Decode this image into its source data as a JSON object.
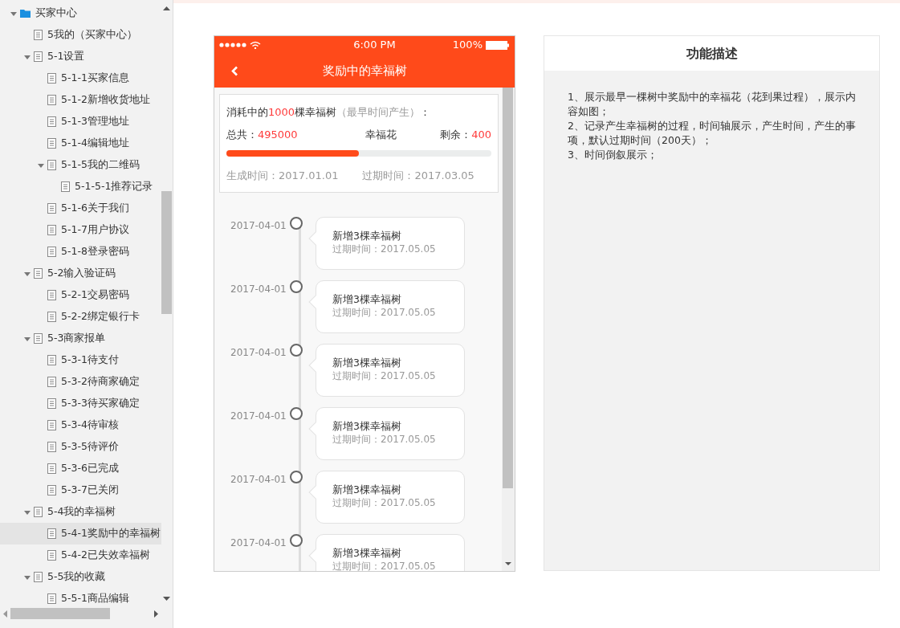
{
  "sidebar": {
    "tree": [
      {
        "label": "买家中心",
        "kind": "folder",
        "expanded": true,
        "selected": false,
        "children": [
          {
            "label": "5我的（买家中心）",
            "kind": "page",
            "selected": false
          },
          {
            "label": "5-1设置",
            "kind": "page",
            "expanded": true,
            "selected": false,
            "children": [
              {
                "label": "5-1-1买家信息",
                "kind": "page",
                "selected": false
              },
              {
                "label": "5-1-2新增收货地址",
                "kind": "page",
                "selected": false
              },
              {
                "label": "5-1-3管理地址",
                "kind": "page",
                "selected": false
              },
              {
                "label": "5-1-4编辑地址",
                "kind": "page",
                "selected": false
              },
              {
                "label": "5-1-5我的二维码",
                "kind": "page",
                "expanded": true,
                "selected": false,
                "children": [
                  {
                    "label": "5-1-5-1推荐记录",
                    "kind": "page",
                    "selected": false
                  }
                ]
              },
              {
                "label": "5-1-6关于我们",
                "kind": "page",
                "selected": false
              },
              {
                "label": "5-1-7用户协议",
                "kind": "page",
                "selected": false
              },
              {
                "label": "5-1-8登录密码",
                "kind": "page",
                "selected": false
              }
            ]
          },
          {
            "label": "5-2输入验证码",
            "kind": "page",
            "expanded": true,
            "selected": false,
            "children": [
              {
                "label": "5-2-1交易密码",
                "kind": "page",
                "selected": false
              },
              {
                "label": "5-2-2绑定银行卡",
                "kind": "page",
                "selected": false
              }
            ]
          },
          {
            "label": "5-3商家报单",
            "kind": "page",
            "expanded": true,
            "selected": false,
            "children": [
              {
                "label": "5-3-1待支付",
                "kind": "page",
                "selected": false
              },
              {
                "label": "5-3-2待商家确定",
                "kind": "page",
                "selected": false
              },
              {
                "label": "5-3-3待买家确定",
                "kind": "page",
                "selected": false
              },
              {
                "label": "5-3-4待审核",
                "kind": "page",
                "selected": false
              },
              {
                "label": "5-3-5待评价",
                "kind": "page",
                "selected": false
              },
              {
                "label": "5-3-6已完成",
                "kind": "page",
                "selected": false
              },
              {
                "label": "5-3-7已关闭",
                "kind": "page",
                "selected": false
              }
            ]
          },
          {
            "label": "5-4我的幸福树",
            "kind": "page",
            "expanded": true,
            "selected": false,
            "children": [
              {
                "label": "5-4-1奖励中的幸福树",
                "kind": "page",
                "selected": true
              },
              {
                "label": "5-4-2已失效幸福树",
                "kind": "page",
                "selected": false
              }
            ]
          },
          {
            "label": "5-5我的收藏",
            "kind": "page",
            "expanded": true,
            "selected": false,
            "children": [
              {
                "label": "5-5-1商品编辑",
                "kind": "page",
                "selected": false
              }
            ]
          }
        ]
      }
    ]
  },
  "phone": {
    "status_bar": {
      "time": "6:00 PM",
      "battery": "100%"
    },
    "nav": {
      "title": "奖励中的幸福树"
    },
    "summary": {
      "heading": {
        "prefix": "消耗中的",
        "count": "1000",
        "suffix": "棵幸福树",
        "note": "（最早时间产生）",
        "colon": "："
      },
      "total_label": "总共：",
      "total_value": "495000",
      "middle": "幸福花",
      "remaining_label": "剩余：",
      "remaining_value": "400",
      "level": 0.5,
      "created": "生成时间：2017.01.01",
      "expires": "过期时间：2017.03.05"
    },
    "timeline": [
      {
        "date": "2017-04-01",
        "title": "新增3棵幸福树",
        "expiry": "过期时间：2017.05.05"
      },
      {
        "date": "2017-04-01",
        "title": "新增3棵幸福树",
        "expiry": "过期时间：2017.05.05"
      },
      {
        "date": "2017-04-01",
        "title": "新增3棵幸福树",
        "expiry": "过期时间：2017.05.05"
      },
      {
        "date": "2017-04-01",
        "title": "新增3棵幸福树",
        "expiry": "过期时间：2017.05.05"
      },
      {
        "date": "2017-04-01",
        "title": "新增3棵幸福树",
        "expiry": "过期时间：2017.05.05"
      },
      {
        "date": "2017-04-01",
        "title": "新增3棵幸福树",
        "expiry": "过期时间：2017.05.05"
      }
    ]
  },
  "description": {
    "title": "功能描述",
    "lines": [
      "1、展示最早一棵树中奖励中的幸福花（花到果过程），展示内容如图；",
      "2、记录产生幸福树的过程，时间轴展示，产生时间，产生的事项，默认过期时间（200天）；",
      "3、时间倒叙展示；"
    ]
  }
}
